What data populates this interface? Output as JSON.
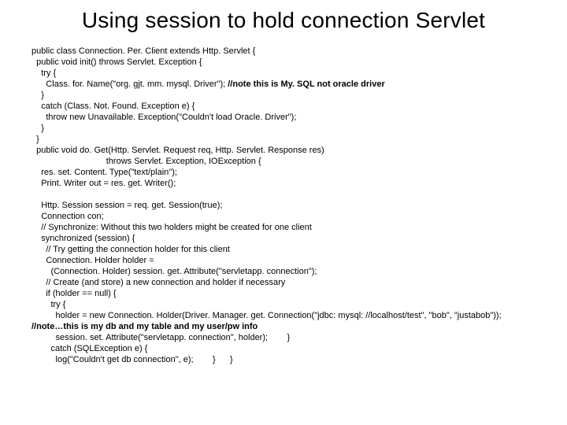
{
  "title": "Using session to hold connection Servlet",
  "code": {
    "l01": "public class Connection. Per. Client extends Http. Servlet {",
    "l02": "  public void init() throws Servlet. Exception {",
    "l03": "    try {",
    "l04_head": "      Class. for. Name(\"org. gjt. mm. mysql. Driver\"); ",
    "l04_bold": "//note this is My. SQL not oracle driver",
    "l05": "    }",
    "l06": "    catch (Class. Not. Found. Exception e) {",
    "l07": "      throw new Unavailable. Exception(\"Couldn't load Oracle. Driver\");",
    "l08": "    }",
    "l09": "  }",
    "l10": "  public void do. Get(Http. Servlet. Request req, Http. Servlet. Response res)",
    "l11": "                               throws Servlet. Exception, IOException {",
    "l12": "    res. set. Content. Type(\"text/plain\");",
    "l13": "    Print. Writer out = res. get. Writer();",
    "l14": "",
    "l15": "    Http. Session session = req. get. Session(true);",
    "l16": "    Connection con;",
    "l17": "    // Synchronize: Without this two holders might be created for one client",
    "l18": "    synchronized (session) {",
    "l19": "      // Try getting the connection holder for this client",
    "l20": "      Connection. Holder holder =",
    "l21": "        (Connection. Holder) session. get. Attribute(\"servletapp. connection\");",
    "l22": "      // Create (and store) a new connection and holder if necessary",
    "l23": "      if (holder == null) {",
    "l24": "        try {",
    "l25": "          holder = new Connection. Holder(Driver. Manager. get. Connection(\"jdbc: mysql: //localhost/test\", \"bob\", \"justabob\"));",
    "l26_bold": "//note…this is my db and my table and my user/pw info",
    "l27": "          session. set. Attribute(\"servletapp. connection\", holder);        }",
    "l28": "        catch (SQLException e) {",
    "l29": "          log(\"Couldn't get db connection\", e);        }      }"
  }
}
